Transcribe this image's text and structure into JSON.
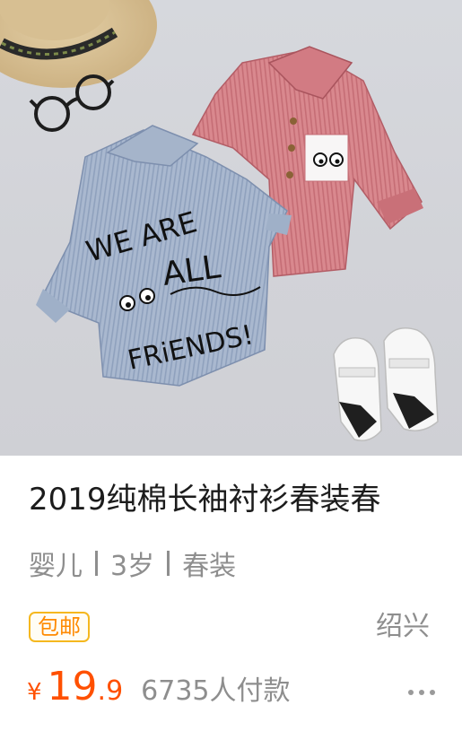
{
  "product": {
    "title": "2019纯棉长袖衬衫春装春",
    "tags": [
      "婴儿",
      "3岁",
      "春装"
    ],
    "badge": "包邮",
    "location": "绍兴",
    "price": {
      "currency": "¥",
      "integer": "19",
      "decimal": ".9"
    },
    "sales": "6735人付款"
  },
  "image": {
    "shirt_print_line1": "WE ARE",
    "shirt_print_line2": "ALL",
    "shirt_print_line3": "FRiENDS!"
  },
  "icons": {
    "more": "more-dots-icon"
  },
  "colors": {
    "price": "#ff5000",
    "badge_border": "#f5b81f",
    "badge_text": "#ff8a00",
    "title": "#1c1c1c",
    "secondary_text": "#8e8e8e"
  }
}
